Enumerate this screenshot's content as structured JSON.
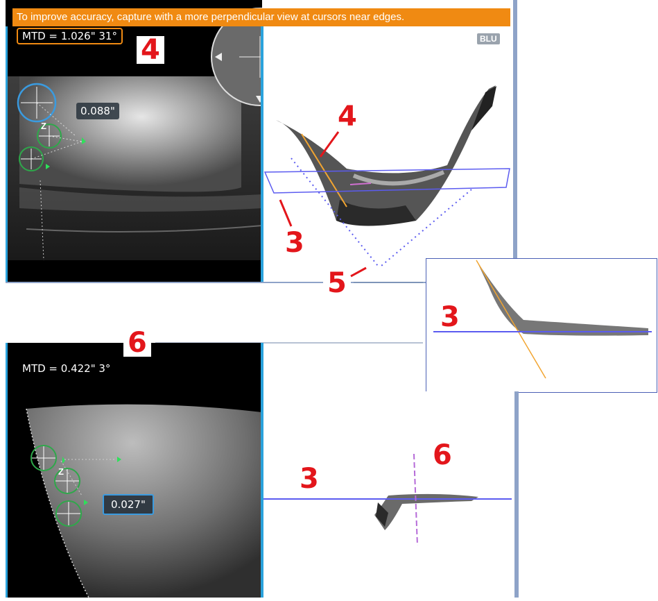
{
  "warning": "To improve accuracy, capture with a more perpendicular view at cursors near edges.",
  "top_panel": {
    "mtd": "MTD = 1.026\" 31°",
    "badge": "BLU",
    "measurement": "0.088\"",
    "cursor_label": "Z"
  },
  "bottom_panel": {
    "mtd": "MTD = 0.422\" 3°",
    "measurement": "0.027\"",
    "cursor_label": "Z"
  },
  "callouts": {
    "top_4": "4",
    "plot_4": "4",
    "plot_3": "3",
    "plot_5": "5",
    "inset_3": "3",
    "bottom_6": "6",
    "plot_6": "6",
    "plot_3b": "3"
  },
  "colors": {
    "warning": "#f08a12",
    "callout": "#e3161b",
    "plane": "#5b5bf0",
    "divider": "#2aa2dc",
    "depth_line": "#f2a531",
    "cursor_blue": "#3a9be0",
    "cursor_green": "#2ea84a"
  }
}
